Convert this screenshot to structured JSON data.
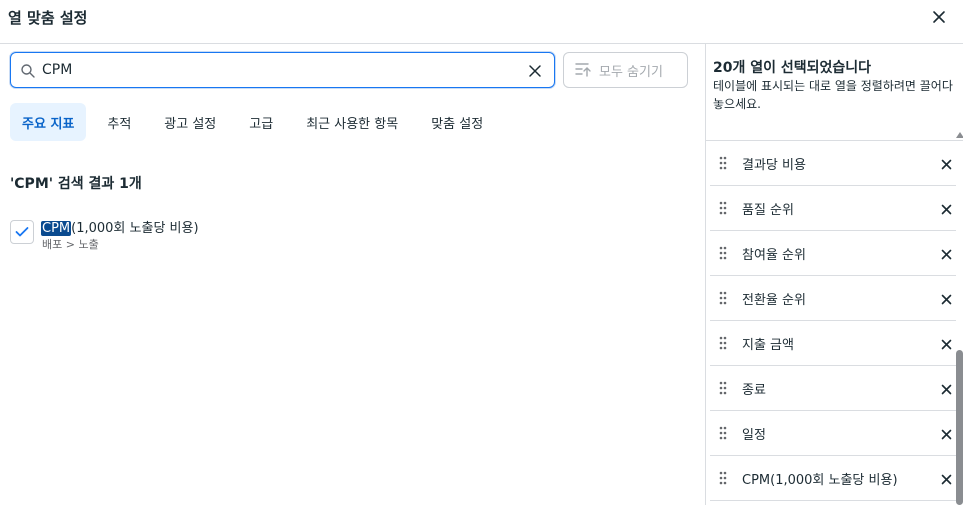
{
  "header": {
    "title": "열 맞춤 설정"
  },
  "search": {
    "value": "CPM"
  },
  "hide_all_label": "모두 숨기기",
  "tabs": [
    {
      "label": "주요 지표",
      "active": true
    },
    {
      "label": "추적",
      "active": false
    },
    {
      "label": "광고 설정",
      "active": false
    },
    {
      "label": "고급",
      "active": false
    },
    {
      "label": "최근 사용한 항목",
      "active": false
    },
    {
      "label": "맞춤 설정",
      "active": false
    }
  ],
  "results": {
    "title": "'CPM' 검색 결과 1개",
    "items": [
      {
        "highlight": "CPM",
        "rest": "(1,000회 노출당 비용)",
        "path": "배포 > 노출",
        "checked": true
      }
    ]
  },
  "selected": {
    "title": "20개 열이 선택되었습니다",
    "description": "테이블에 표시되는 대로 열을 정렬하려면 끌어다 놓으세요.",
    "items": [
      {
        "label": "결과당 비용"
      },
      {
        "label": "품질 순위"
      },
      {
        "label": "참여율 순위"
      },
      {
        "label": "전환율 순위"
      },
      {
        "label": "지출 금액"
      },
      {
        "label": "종료"
      },
      {
        "label": "일정"
      },
      {
        "label": "CPM(1,000회 노출당 비용)"
      }
    ]
  },
  "colors": {
    "accent": "#1877f2",
    "highlight": "#0a4a8f",
    "tab_active_bg": "#e7f3ff"
  },
  "icons": {
    "close": "close-icon",
    "search": "search-icon",
    "clear": "clear-icon",
    "hide_all": "collapse-columns-icon",
    "check": "check-icon",
    "drag": "drag-handle-icon",
    "remove": "remove-icon"
  }
}
